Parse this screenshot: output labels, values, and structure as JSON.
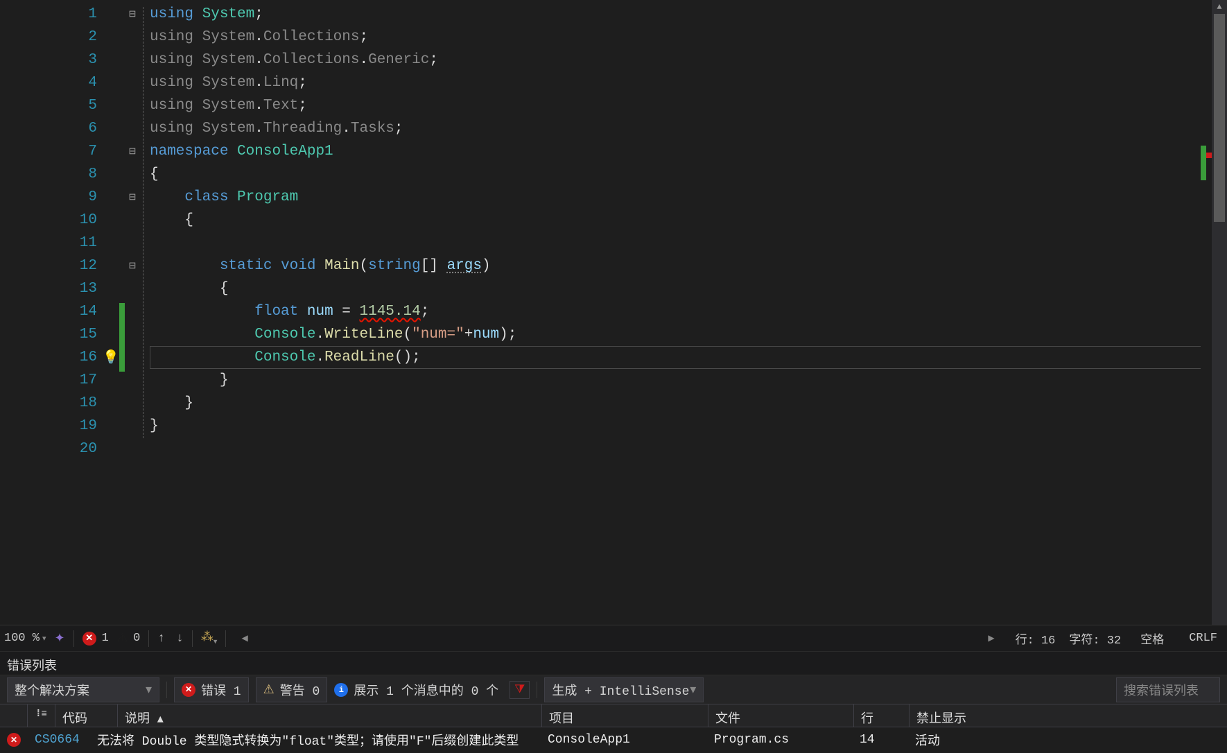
{
  "code": {
    "lines": [
      {
        "n": 1,
        "fold": "⊟",
        "tokens": [
          [
            "k-blue",
            "using"
          ],
          [
            "k-plain",
            " "
          ],
          [
            "k-type",
            "System"
          ],
          [
            "k-plain",
            ";"
          ]
        ]
      },
      {
        "n": 2,
        "tokens": [
          [
            "k-using",
            "using"
          ],
          [
            "k-plain",
            " "
          ],
          [
            "k-using",
            "System"
          ],
          [
            "k-plain",
            "."
          ],
          [
            "k-using",
            "Collections"
          ],
          [
            "k-plain",
            ";"
          ]
        ]
      },
      {
        "n": 3,
        "tokens": [
          [
            "k-using",
            "using"
          ],
          [
            "k-plain",
            " "
          ],
          [
            "k-using",
            "System"
          ],
          [
            "k-plain",
            "."
          ],
          [
            "k-using",
            "Collections"
          ],
          [
            "k-plain",
            "."
          ],
          [
            "k-using",
            "Generic"
          ],
          [
            "k-plain",
            ";"
          ]
        ]
      },
      {
        "n": 4,
        "tokens": [
          [
            "k-using",
            "using"
          ],
          [
            "k-plain",
            " "
          ],
          [
            "k-using",
            "System"
          ],
          [
            "k-plain",
            "."
          ],
          [
            "k-using",
            "Linq"
          ],
          [
            "k-plain",
            ";"
          ]
        ]
      },
      {
        "n": 5,
        "tokens": [
          [
            "k-using",
            "using"
          ],
          [
            "k-plain",
            " "
          ],
          [
            "k-using",
            "System"
          ],
          [
            "k-plain",
            "."
          ],
          [
            "k-using",
            "Text"
          ],
          [
            "k-plain",
            ";"
          ]
        ]
      },
      {
        "n": 6,
        "tokens": [
          [
            "k-using",
            "using"
          ],
          [
            "k-plain",
            " "
          ],
          [
            "k-using",
            "System"
          ],
          [
            "k-plain",
            "."
          ],
          [
            "k-using",
            "Threading"
          ],
          [
            "k-plain",
            "."
          ],
          [
            "k-using",
            "Tasks"
          ],
          [
            "k-plain",
            ";"
          ]
        ]
      },
      {
        "n": 7,
        "fold": "⊟",
        "tokens": [
          [
            "k-blue",
            "namespace"
          ],
          [
            "k-plain",
            " "
          ],
          [
            "k-type",
            "ConsoleApp1"
          ]
        ]
      },
      {
        "n": 8,
        "tokens": [
          [
            "k-plain",
            "{"
          ]
        ]
      },
      {
        "n": 9,
        "fold": "⊟",
        "indent": 1,
        "tokens": [
          [
            "k-blue",
            "class"
          ],
          [
            "k-plain",
            " "
          ],
          [
            "k-type",
            "Program"
          ]
        ]
      },
      {
        "n": 10,
        "indent": 1,
        "tokens": [
          [
            "k-plain",
            "{"
          ]
        ]
      },
      {
        "n": 11,
        "indent": 1,
        "tokens": [
          [
            "k-plain",
            ""
          ]
        ]
      },
      {
        "n": 12,
        "fold": "⊟",
        "indent": 2,
        "tokens": [
          [
            "k-blue",
            "static"
          ],
          [
            "k-plain",
            " "
          ],
          [
            "k-blue",
            "void"
          ],
          [
            "k-plain",
            " "
          ],
          [
            "k-method",
            "Main"
          ],
          [
            "k-plain",
            "("
          ],
          [
            "k-blue",
            "string"
          ],
          [
            "k-plain",
            "[] "
          ],
          [
            "k-var dotted-under",
            "args"
          ],
          [
            "k-plain",
            ")"
          ]
        ]
      },
      {
        "n": 13,
        "indent": 2,
        "tokens": [
          [
            "k-plain",
            "{"
          ]
        ]
      },
      {
        "n": 14,
        "mod": true,
        "indent": 3,
        "tokens": [
          [
            "k-blue",
            "float"
          ],
          [
            "k-plain",
            " "
          ],
          [
            "k-var",
            "num"
          ],
          [
            "k-plain",
            " = "
          ],
          [
            "k-num squiggle",
            "1145.14"
          ],
          [
            "k-plain",
            ";"
          ]
        ]
      },
      {
        "n": 15,
        "mod": true,
        "indent": 3,
        "tokens": [
          [
            "k-type",
            "Console"
          ],
          [
            "k-plain",
            "."
          ],
          [
            "k-method",
            "WriteLine"
          ],
          [
            "k-plain",
            "("
          ],
          [
            "k-str",
            "\"num=\""
          ],
          [
            "k-plain",
            "+"
          ],
          [
            "k-var",
            "num"
          ],
          [
            "k-plain",
            ");"
          ]
        ]
      },
      {
        "n": 16,
        "mod": true,
        "current": true,
        "indent": 3,
        "tokens": [
          [
            "k-type",
            "Console"
          ],
          [
            "k-plain",
            "."
          ],
          [
            "k-method",
            "ReadLine"
          ],
          [
            "k-plain",
            "();"
          ]
        ]
      },
      {
        "n": 17,
        "indent": 2,
        "tokens": [
          [
            "k-plain",
            "}"
          ]
        ]
      },
      {
        "n": 18,
        "indent": 1,
        "tokens": [
          [
            "k-plain",
            "}"
          ]
        ]
      },
      {
        "n": 19,
        "tokens": [
          [
            "k-plain",
            "}"
          ]
        ]
      },
      {
        "n": 20,
        "tokens": [
          [
            "k-plain",
            ""
          ]
        ]
      }
    ]
  },
  "status": {
    "zoom": "100 %",
    "errors": "1",
    "warnings": "0",
    "line_label": "行:",
    "line_val": "16",
    "col_label": "字符:",
    "col_val": "32",
    "ins_mode": "空格",
    "crlf": "CRLF"
  },
  "error_panel": {
    "title": "错误列表",
    "scope": "整个解决方案",
    "filter": "生成 + IntelliSense",
    "search_placeholder": "搜索错误列表",
    "btn_errors": "错误 1",
    "btn_warnings": "警告 0",
    "btn_messages": "展示 1 个消息中的 0 个",
    "hdr_code": "代码",
    "hdr_desc": "说明",
    "hdr_proj": "项目",
    "hdr_file": "文件",
    "hdr_line": "行",
    "hdr_supp": "禁止显示",
    "rows": [
      {
        "code": "CS0664",
        "desc": "无法将 Double 类型隐式转换为\"float\"类型；请使用\"F\"后缀创建此类型",
        "proj": "ConsoleApp1",
        "file": "Program.cs",
        "line": "14",
        "supp": "活动"
      }
    ]
  }
}
